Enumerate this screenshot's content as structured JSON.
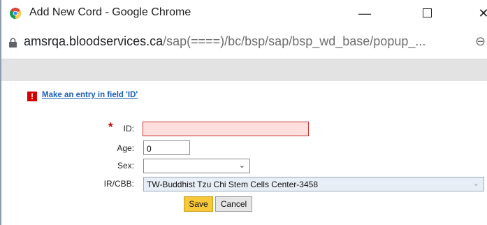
{
  "window": {
    "title": "Add New Cord - Google Chrome",
    "minimize_glyph": "—",
    "close_glyph": "✕",
    "edge_glyph": "⊖"
  },
  "address": {
    "host": "amsrqa.bloodservices.ca",
    "path": "/sap(====)/bc/bsp/sap/bsp_wd_base/popup_..."
  },
  "message": {
    "icon_glyph": "!",
    "text": "Make an entry in field 'ID'"
  },
  "form": {
    "required_marker": "*",
    "id_label": "ID:",
    "id_value": "",
    "age_label": "Age:",
    "age_value": "0",
    "sex_label": "Sex:",
    "sex_value": "",
    "ir_label": "IR/CBB:",
    "ir_value": "TW-Buddhist Tzu Chi Stem Cells Center-3458",
    "chevron_glyph": "⌄"
  },
  "buttons": {
    "save": "Save",
    "cancel": "Cancel"
  },
  "colors": {
    "error_field_bg": "#ffdede",
    "error_border": "#c83434",
    "save_button": "#f7c83a",
    "link": "#1a5fb4",
    "required": "#c00000"
  }
}
